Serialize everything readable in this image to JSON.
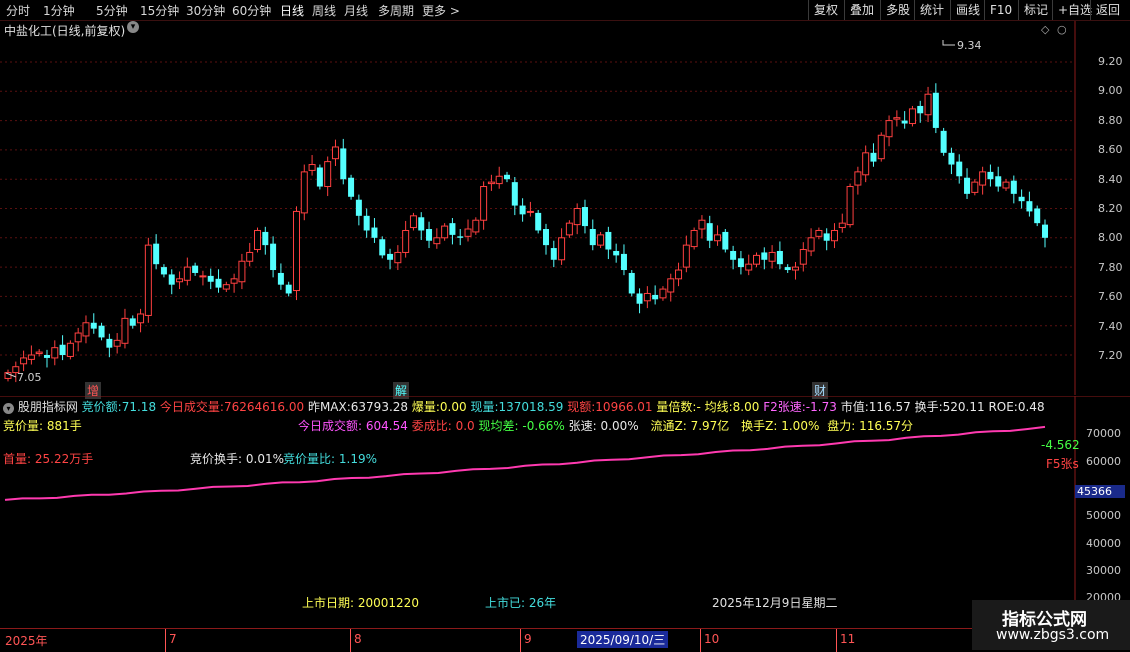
{
  "toolbar": {
    "periods": [
      "分时",
      "1分钟",
      "5分钟",
      "15分钟",
      "30分钟",
      "60分钟",
      "日线",
      "周线",
      "月线",
      "多周期",
      "更多 >"
    ],
    "right_buttons": [
      "复权",
      "叠加",
      "多股",
      "统计",
      "画线",
      "F10",
      "标记",
      "+自选",
      "返回"
    ]
  },
  "header": {
    "title": "中盐化工(日线,前复权)",
    "dropdown_icon": "chevron-down-circle-icon"
  },
  "price_axis": {
    "ticks": [
      "9.20",
      "9.00",
      "8.80",
      "8.60",
      "8.40",
      "8.20",
      "8.00",
      "7.80",
      "7.60",
      "7.40",
      "7.20"
    ]
  },
  "annotations": {
    "high_label": "9.34",
    "low_label": "7.05",
    "markers": [
      "增",
      "解",
      "财"
    ]
  },
  "indicator": {
    "name": "股朋指标网",
    "row1": [
      {
        "label": "竞价额:",
        "value": "71.18",
        "color": "#44dddd"
      },
      {
        "label": "今日成交量:",
        "value": "76264616.00",
        "color": "#ff4444"
      },
      {
        "label": "昨MAX:",
        "value": "63793.28",
        "color": "#e8e8e8"
      },
      {
        "label": "爆量:",
        "value": "0.00",
        "color": "#ffff55"
      },
      {
        "label": "现量:",
        "value": "137018.59",
        "color": "#44dddd"
      },
      {
        "label": "现额:",
        "value": "10966.01",
        "color": "#ff4444"
      },
      {
        "label": "量倍数:",
        "value": "-",
        "color": "#ffff55"
      },
      {
        "label": "均线:",
        "value": "8.00",
        "color": "#ffff55"
      },
      {
        "label": "F2张速:",
        "value": "-1.73",
        "color": "#ff66ff"
      },
      {
        "label": "市值:",
        "value": "116.57",
        "color": "#e8e8e8"
      },
      {
        "label": "换手:",
        "value": "520.11",
        "color": "#e8e8e8"
      },
      {
        "label": "ROE:",
        "value": "0.48",
        "color": "#e8e8e8"
      }
    ],
    "jingjialiang": {
      "label": "竞价量:",
      "value": "881手"
    },
    "row2": [
      {
        "label": "今日成交额:",
        "value": "604.54",
        "color": "#ff55ff"
      },
      {
        "label": "委成比:",
        "value": "0.0",
        "color": "#ff4444"
      },
      {
        "label": "现均差:",
        "value": "-0.66%",
        "color": "#44ff44"
      },
      {
        "label": "张速:",
        "value": "0.00%",
        "color": "#e8e8e8"
      },
      {
        "label": "流通Z:",
        "value": "7.97亿",
        "color": "#ffff55"
      },
      {
        "label": "换手Z:",
        "value": "1.00%",
        "color": "#ffff55"
      },
      {
        "label": "盘力:",
        "value": "116.57分",
        "color": "#ffff55"
      }
    ],
    "shouliang": {
      "label": "首量:",
      "value": "25.22万手"
    },
    "jingjia_huanshou": {
      "label": "竞价换手:",
      "value": "0.01%"
    },
    "jingjia_liangbi": {
      "label": "竞价量比:",
      "value": "1.19%"
    },
    "right_green": "-4.562",
    "right_red": "F5张s",
    "axis_ticks": [
      "70000",
      "60000",
      "50000",
      "40000",
      "30000",
      "20000",
      "10000"
    ],
    "current_value": "45366",
    "listing_date": {
      "label": "上市日期:",
      "value": "20001220"
    },
    "listed_years": {
      "label": "上市已:",
      "value": "26年"
    },
    "today": "2025年12月9日星期二"
  },
  "xaxis": {
    "year": "2025年",
    "months": [
      "7",
      "8",
      "9",
      "10",
      "11"
    ],
    "cursor_date": "2025/09/10/三"
  },
  "watermark": {
    "line1": "指标公式网",
    "line2": "www.zbgs3.com"
  },
  "chart_data": {
    "type": "candlestick",
    "title": "中盐化工(日线,前复权)",
    "ylim": [
      7.05,
      9.34
    ],
    "high": 9.34,
    "low": 7.05,
    "close_series": [
      7.08,
      7.12,
      7.18,
      7.2,
      7.22,
      7.18,
      7.25,
      7.2,
      7.28,
      7.35,
      7.42,
      7.38,
      7.32,
      7.25,
      7.3,
      7.45,
      7.4,
      7.48,
      7.95,
      7.82,
      7.75,
      7.68,
      7.72,
      7.8,
      7.76,
      7.74,
      7.7,
      7.66,
      7.68,
      7.72,
      7.84,
      7.9,
      8.05,
      7.95,
      7.78,
      7.68,
      7.62,
      8.18,
      8.45,
      8.5,
      8.35,
      8.52,
      8.62,
      8.4,
      8.28,
      8.15,
      8.05,
      8.0,
      7.88,
      7.85,
      7.9,
      8.05,
      8.15,
      8.05,
      7.98,
      8.0,
      8.08,
      8.02,
      8.0,
      8.06,
      8.12,
      8.35,
      8.38,
      8.42,
      8.4,
      8.22,
      8.16,
      8.18,
      8.05,
      7.95,
      7.85,
      8.0,
      8.1,
      8.2,
      8.08,
      7.95,
      8.02,
      7.92,
      7.88,
      7.78,
      7.62,
      7.55,
      7.62,
      7.58,
      7.65,
      7.72,
      7.78,
      7.95,
      8.05,
      8.12,
      7.98,
      8.02,
      7.92,
      7.85,
      7.8,
      7.82,
      7.88,
      7.85,
      7.9,
      7.82,
      7.78,
      7.8,
      7.92,
      8.0,
      8.05,
      7.98,
      8.05,
      8.1,
      8.35,
      8.45,
      8.58,
      8.52,
      8.7,
      8.8,
      8.82,
      8.78,
      8.88,
      8.85,
      8.98,
      8.75,
      8.58,
      8.5,
      8.42,
      8.3,
      8.38,
      8.45,
      8.4,
      8.35,
      8.38,
      8.3,
      8.25,
      8.18,
      8.1,
      8.0
    ],
    "sub_series_range": [
      45366,
      72000
    ]
  }
}
